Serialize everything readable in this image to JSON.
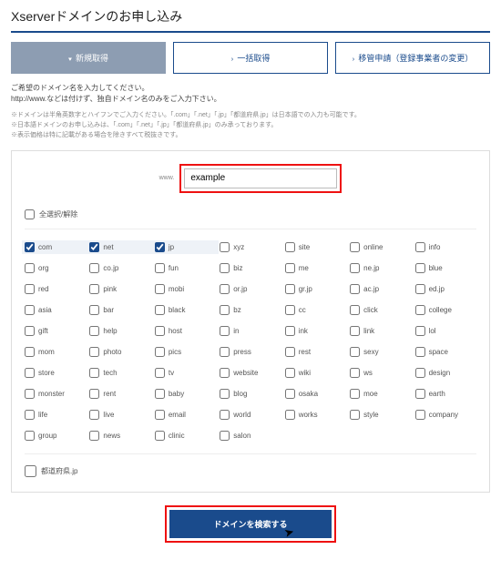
{
  "page_title": "Xserverドメインのお申し込み",
  "tabs": [
    {
      "label": "新規取得",
      "arrow": "▾"
    },
    {
      "label": "一括取得",
      "arrow": "›"
    },
    {
      "label": "移管申請（登録事業者の変更）",
      "arrow": "›"
    }
  ],
  "intro_line1": "ご希望のドメイン名を入力してください。",
  "intro_line2": "http://www.などは付けず、独自ドメイン名のみをご入力下さい。",
  "note1": "※ドメインは半角英数字とハイフンでご入力ください。「.com」「.net」「.jp」「都道府県.jp」は日本語での入力も可能です。",
  "note2": "※日本語ドメインのお申し込みは、「.com」「.net」「.jp」「都道府県.jp」のみ承っております。",
  "note3": "※表示価格は特に記載がある場合を除きすべて税抜きです。",
  "www_label": "www.",
  "search_value": "example",
  "select_all_label": "全選択/解除",
  "tlds": [
    {
      "n": "com",
      "c": true,
      "h": true
    },
    {
      "n": "net",
      "c": true,
      "h": true
    },
    {
      "n": "jp",
      "c": true,
      "h": true
    },
    {
      "n": "xyz",
      "c": false
    },
    {
      "n": "site",
      "c": false
    },
    {
      "n": "online",
      "c": false
    },
    {
      "n": "info",
      "c": false
    },
    {
      "n": "org",
      "c": false
    },
    {
      "n": "co.jp",
      "c": false
    },
    {
      "n": "fun",
      "c": false
    },
    {
      "n": "biz",
      "c": false
    },
    {
      "n": "me",
      "c": false
    },
    {
      "n": "ne.jp",
      "c": false
    },
    {
      "n": "blue",
      "c": false
    },
    {
      "n": "red",
      "c": false
    },
    {
      "n": "pink",
      "c": false
    },
    {
      "n": "mobi",
      "c": false
    },
    {
      "n": "or.jp",
      "c": false
    },
    {
      "n": "gr.jp",
      "c": false
    },
    {
      "n": "ac.jp",
      "c": false
    },
    {
      "n": "ed.jp",
      "c": false
    },
    {
      "n": "asia",
      "c": false
    },
    {
      "n": "bar",
      "c": false
    },
    {
      "n": "black",
      "c": false
    },
    {
      "n": "bz",
      "c": false
    },
    {
      "n": "cc",
      "c": false
    },
    {
      "n": "click",
      "c": false
    },
    {
      "n": "college",
      "c": false
    },
    {
      "n": "gift",
      "c": false
    },
    {
      "n": "help",
      "c": false
    },
    {
      "n": "host",
      "c": false
    },
    {
      "n": "in",
      "c": false
    },
    {
      "n": "ink",
      "c": false
    },
    {
      "n": "link",
      "c": false
    },
    {
      "n": "lol",
      "c": false
    },
    {
      "n": "mom",
      "c": false
    },
    {
      "n": "photo",
      "c": false
    },
    {
      "n": "pics",
      "c": false
    },
    {
      "n": "press",
      "c": false
    },
    {
      "n": "rest",
      "c": false
    },
    {
      "n": "sexy",
      "c": false
    },
    {
      "n": "space",
      "c": false
    },
    {
      "n": "store",
      "c": false
    },
    {
      "n": "tech",
      "c": false
    },
    {
      "n": "tv",
      "c": false
    },
    {
      "n": "website",
      "c": false
    },
    {
      "n": "wiki",
      "c": false
    },
    {
      "n": "ws",
      "c": false
    },
    {
      "n": "design",
      "c": false
    },
    {
      "n": "monster",
      "c": false
    },
    {
      "n": "rent",
      "c": false
    },
    {
      "n": "baby",
      "c": false
    },
    {
      "n": "blog",
      "c": false
    },
    {
      "n": "osaka",
      "c": false
    },
    {
      "n": "moe",
      "c": false
    },
    {
      "n": "earth",
      "c": false
    },
    {
      "n": "life",
      "c": false
    },
    {
      "n": "live",
      "c": false
    },
    {
      "n": "email",
      "c": false
    },
    {
      "n": "world",
      "c": false
    },
    {
      "n": "works",
      "c": false
    },
    {
      "n": "style",
      "c": false
    },
    {
      "n": "company",
      "c": false
    },
    {
      "n": "group",
      "c": false
    },
    {
      "n": "news",
      "c": false
    },
    {
      "n": "clinic",
      "c": false
    },
    {
      "n": "salon",
      "c": false
    }
  ],
  "pref_label": "都道府県.jp",
  "submit_label": "ドメインを検索する"
}
